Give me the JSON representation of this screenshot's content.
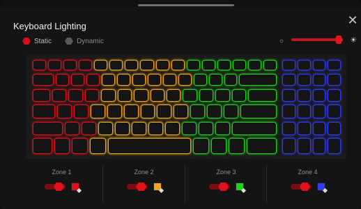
{
  "title": "Keyboard  Lighting",
  "modes": {
    "static": "Static",
    "dynamic": "Dynamic"
  },
  "icons": {
    "close": "close-icon",
    "brightness_low": "brightness-low-icon",
    "brightness_high": "brightness-high-icon",
    "edit": "pencil-icon"
  },
  "brightness": {
    "value": 0.92
  },
  "zones": [
    {
      "label": "Zone 1",
      "color": "#e0111b",
      "enabled": true
    },
    {
      "label": "Zone 2",
      "color": "#f2a51f",
      "enabled": true
    },
    {
      "label": "Zone 3",
      "color": "#21d11b",
      "enabled": true
    },
    {
      "label": "Zone 4",
      "color": "#2f3df2",
      "enabled": true
    }
  ]
}
